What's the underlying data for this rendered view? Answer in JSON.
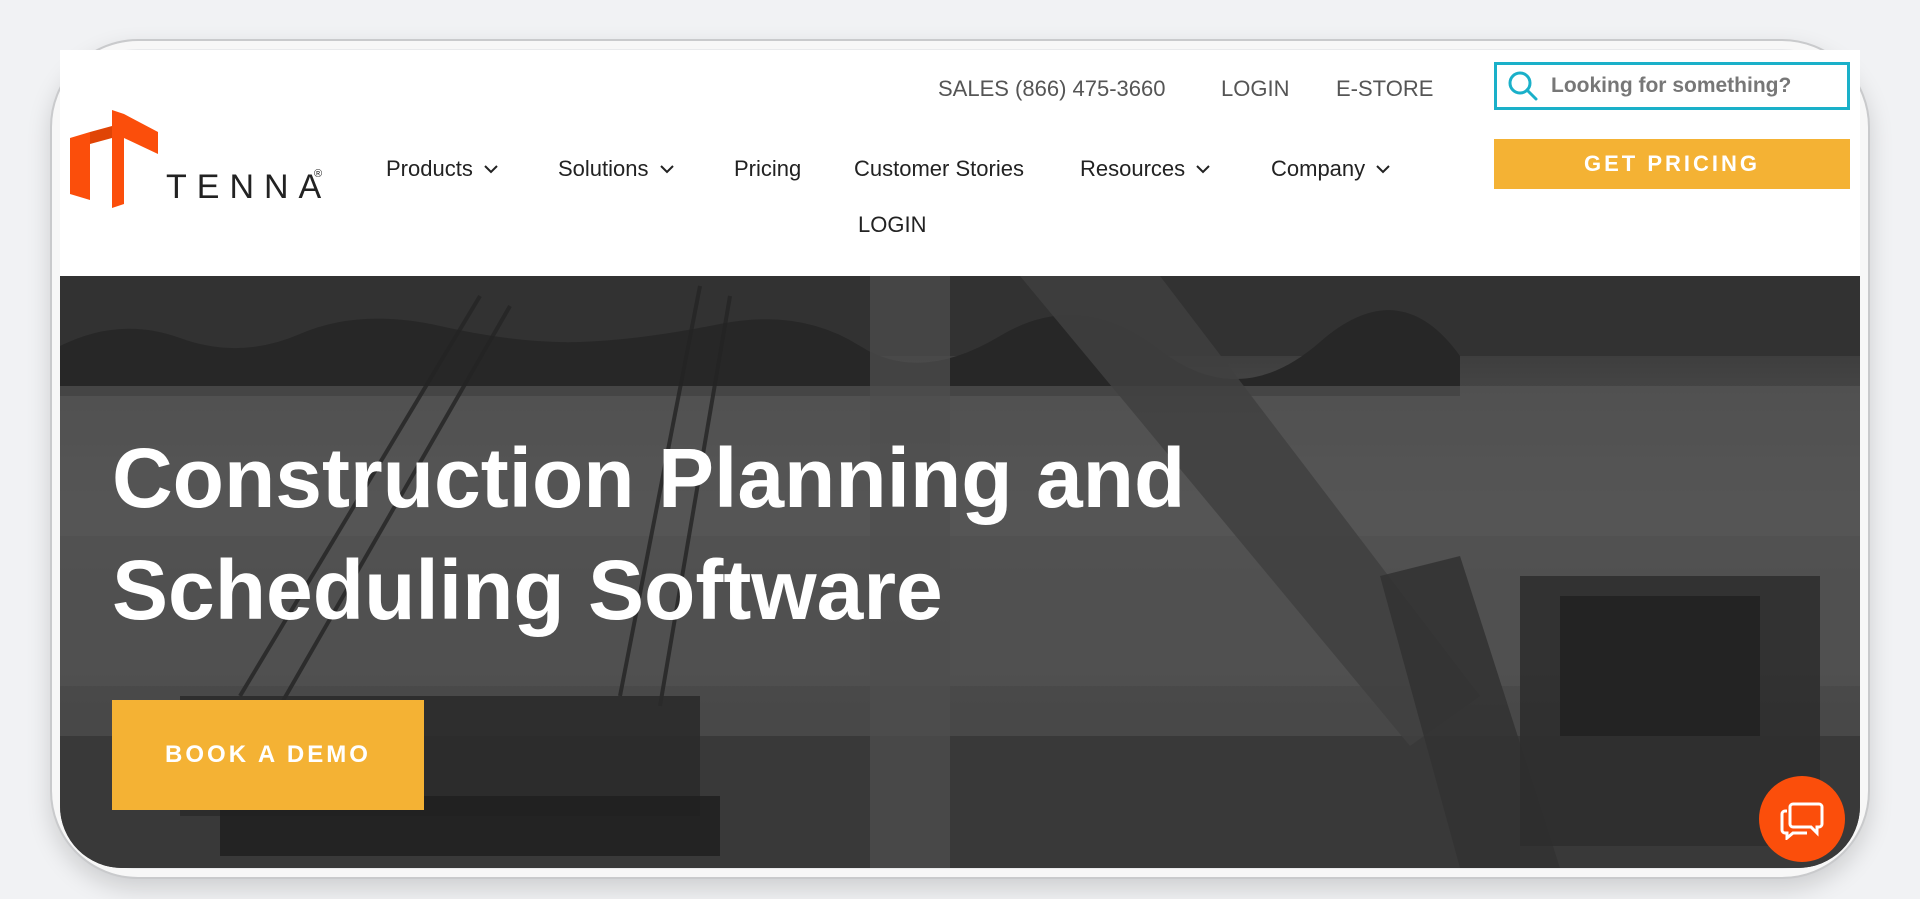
{
  "brand": {
    "name": "TENNA",
    "registered": "®",
    "accent_orange": "#fb4e0b",
    "cta_yellow": "#f4b234",
    "search_border": "#1ab0c9"
  },
  "utility_nav": {
    "sales": "SALES (866) 475-3660",
    "login": "LOGIN",
    "estore": "E-STORE"
  },
  "search": {
    "placeholder": "Looking for something?",
    "icon": "search-icon"
  },
  "main_nav": {
    "items": [
      {
        "label": "Products",
        "has_dropdown": true
      },
      {
        "label": "Solutions",
        "has_dropdown": true
      },
      {
        "label": "Pricing",
        "has_dropdown": false
      },
      {
        "label": "Customer Stories",
        "has_dropdown": false
      },
      {
        "label": "Resources",
        "has_dropdown": true
      },
      {
        "label": "Company",
        "has_dropdown": true
      }
    ],
    "login": "LOGIN"
  },
  "cta": {
    "get_pricing": "GET PRICING"
  },
  "hero": {
    "title_line1": "Construction Planning and",
    "title_line2": "Scheduling Software",
    "book_demo": "BOOK A DEMO"
  },
  "chat": {
    "icon": "chat-icon"
  }
}
